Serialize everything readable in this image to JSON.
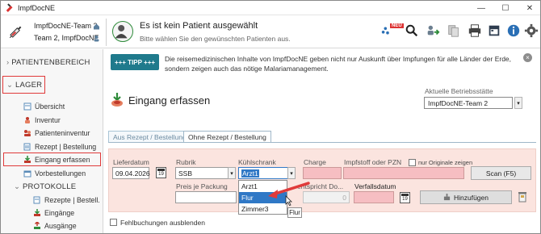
{
  "window": {
    "title": "ImpfDocNE",
    "controls": [
      "—",
      "☐",
      "✕"
    ]
  },
  "header": {
    "team_line1": "ImpfDocNE-Team 2",
    "team_line2": "Team 2, ImpfDocNE",
    "patient_title": "Es ist kein Patient ausgewählt",
    "patient_sub": "Bitte wählen Sie den gewünschten Patienten aus.",
    "toolbar_icons": [
      "new-patient-icon",
      "search-icon",
      "transfer-icon",
      "documents-icon",
      "print-icon",
      "calendar-icon",
      "info-icon",
      "settings-icon"
    ],
    "new_badge": "NEU"
  },
  "sidebar": {
    "patientenbereich": "PATIENTENBEREICH",
    "lager": "LAGER",
    "items": [
      {
        "label": "Übersicht",
        "icon": "overview-icon"
      },
      {
        "label": "Inventur",
        "icon": "inventory-icon"
      },
      {
        "label": "Patienteninventur",
        "icon": "patient-inventory-icon"
      },
      {
        "label": "Rezept | Bestellung",
        "icon": "prescription-icon"
      },
      {
        "label": "Eingang erfassen",
        "icon": "incoming-icon"
      },
      {
        "label": "Vorbestellungen",
        "icon": "preorder-icon"
      }
    ],
    "protokolle": "PROTOKOLLE",
    "protokolle_items": [
      {
        "label": "Rezepte | Bestell.",
        "icon": "prescription-icon"
      },
      {
        "label": "Eingänge",
        "icon": "incoming-icon"
      },
      {
        "label": "Ausgänge",
        "icon": "outgoing-icon"
      }
    ]
  },
  "tip": {
    "button": "+++ TIPP +++",
    "text": "Die reisemedizinischen Inhalte von ImpfDocNE geben nicht nur Auskunft über Impfungen für alle Länder der Erde, sondern zeigen auch das nötige Malariamanagement."
  },
  "main": {
    "title": "Eingang erfassen",
    "betriebsstaette_label": "Aktuelle Betriebsstätte",
    "betriebsstaette_value": "ImpfDocNE-Team 2",
    "tabs": [
      "Aus Rezept / Bestellung",
      "Ohne Rezept / Bestellung"
    ],
    "active_tab": 1
  },
  "form": {
    "lieferdatum_label": "Lieferdatum",
    "lieferdatum_value": "09.04.2026",
    "rubrik_label": "Rubrik",
    "rubrik_value": "SSB",
    "kuehlschrank_label": "Kühlschrank",
    "kuehlschrank_value": "Arzt1",
    "charge_label": "Charge",
    "impfstoff_label": "Impfstoff oder PZN",
    "nur_originale_label": "nur Originale zeigen",
    "scan_button": "Scan (F5)",
    "preis_label": "Preis je Packung",
    "entspricht_label": "entspricht Do...",
    "entspricht_value": "0",
    "verfallsdatum_label": "Verfallsdatum",
    "hinzufuegen_button": "Hinzufügen",
    "dropdown_options": [
      "Arzt1",
      "Flur",
      "Zimmer3"
    ],
    "dropdown_selected": 1,
    "tooltip": "Flur"
  },
  "footer": {
    "fehlbuchungen_label": "Fehlbuchungen ausblenden"
  },
  "colors": {
    "accent": "#1f7a8c",
    "highlight": "#e03a3a",
    "form_bg": "#fbe4df",
    "selected": "#2f78c6"
  }
}
